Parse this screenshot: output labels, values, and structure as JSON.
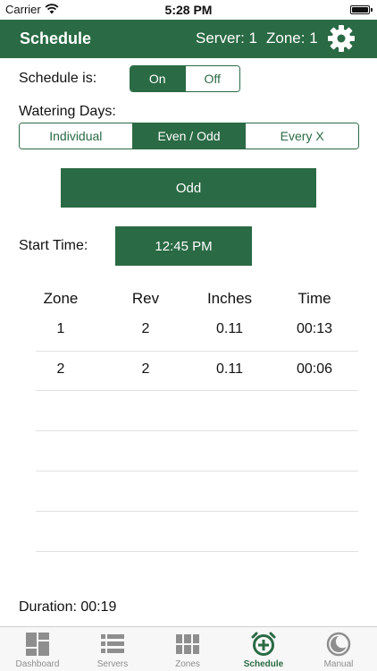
{
  "status_bar": {
    "carrier": "Carrier",
    "time": "5:28 PM"
  },
  "nav": {
    "title": "Schedule",
    "server": "Server: 1",
    "zone": "Zone: 1"
  },
  "schedule": {
    "label": "Schedule is:",
    "options": [
      "On",
      "Off"
    ],
    "selected": "On"
  },
  "watering": {
    "label": "Watering Days:",
    "options": [
      "Individual",
      "Even / Odd",
      "Every X"
    ],
    "selected": "Even / Odd",
    "mode_button": "Odd"
  },
  "start_time": {
    "label": "Start Time:",
    "value": "12:45 PM"
  },
  "table": {
    "headers": [
      "Zone",
      "Rev",
      "Inches",
      "Time"
    ],
    "rows": [
      [
        "1",
        "2",
        "0.11",
        "00:13"
      ],
      [
        "2",
        "2",
        "0.11",
        "00:06"
      ]
    ]
  },
  "duration": "Duration: 00:19",
  "tabs": [
    {
      "label": "Dashboard",
      "icon": "dashboard-icon"
    },
    {
      "label": "Servers",
      "icon": "servers-icon"
    },
    {
      "label": "Zones",
      "icon": "zones-icon"
    },
    {
      "label": "Schedule",
      "icon": "schedule-alarm-icon",
      "active": true
    },
    {
      "label": "Manual",
      "icon": "manual-icon"
    }
  ],
  "colors": {
    "primary": "#2a6a44",
    "tab_inactive": "#8e8e8e"
  }
}
